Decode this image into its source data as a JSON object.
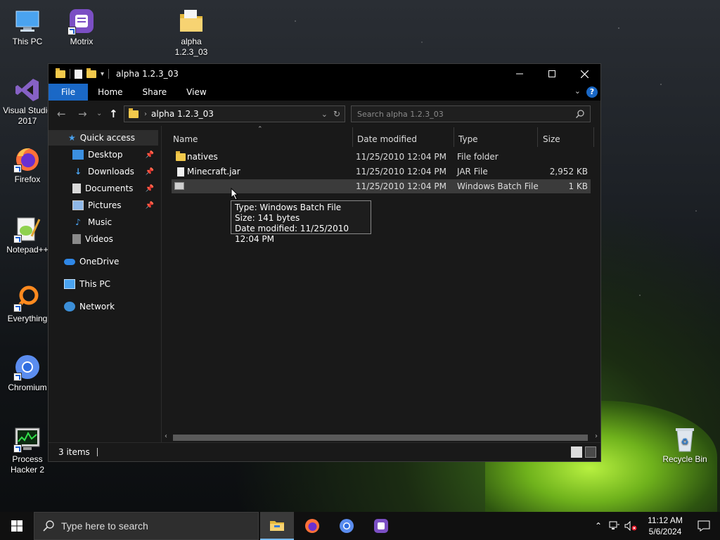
{
  "desktop": {
    "icons": [
      {
        "label": "This PC"
      },
      {
        "label": "Motrix"
      },
      {
        "label": "alpha 1.2.3_03"
      },
      {
        "label": "Visual Studio 2017"
      },
      {
        "label": "Firefox"
      },
      {
        "label": "Notepad++"
      },
      {
        "label": "Everything"
      },
      {
        "label": "Chromium"
      },
      {
        "label": "Process Hacker 2"
      },
      {
        "label": "Recycle Bin"
      }
    ]
  },
  "window": {
    "title": "alpha 1.2.3_03",
    "ribbon_tabs": [
      "File",
      "Home",
      "Share",
      "View"
    ],
    "address": {
      "path": "alpha 1.2.3_03"
    },
    "search": {
      "placeholder": "Search alpha 1.2.3_03"
    },
    "nav": [
      {
        "label": "Quick access"
      },
      {
        "label": "Desktop",
        "pinned": true
      },
      {
        "label": "Downloads",
        "pinned": true
      },
      {
        "label": "Documents",
        "pinned": true
      },
      {
        "label": "Pictures",
        "pinned": true
      },
      {
        "label": "Music"
      },
      {
        "label": "Videos"
      },
      {
        "label": "OneDrive"
      },
      {
        "label": "This PC"
      },
      {
        "label": "Network"
      }
    ],
    "columns": [
      "Name",
      "Date modified",
      "Type",
      "Size"
    ],
    "files": [
      {
        "name": "natives",
        "date": "11/25/2010 12:04 PM",
        "type": "File folder",
        "size": ""
      },
      {
        "name": "Minecraft.jar",
        "date": "11/25/2010 12:04 PM",
        "type": "JAR File",
        "size": "2,952 KB"
      },
      {
        "name": "",
        "date": "11/25/2010 12:04 PM",
        "type": "Windows Batch File",
        "size": "1 KB"
      }
    ],
    "tooltip": {
      "line1": "Type: Windows Batch File",
      "line2": "Size: 141 bytes",
      "line3": "Date modified: 11/25/2010 12:04 PM"
    },
    "status": {
      "items": "3 items"
    }
  },
  "taskbar": {
    "search_placeholder": "Type here to search",
    "time": "11:12 AM",
    "date": "5/6/2024"
  },
  "colors": {
    "accent": "#1a68c6",
    "folder": "#f2c94c"
  }
}
